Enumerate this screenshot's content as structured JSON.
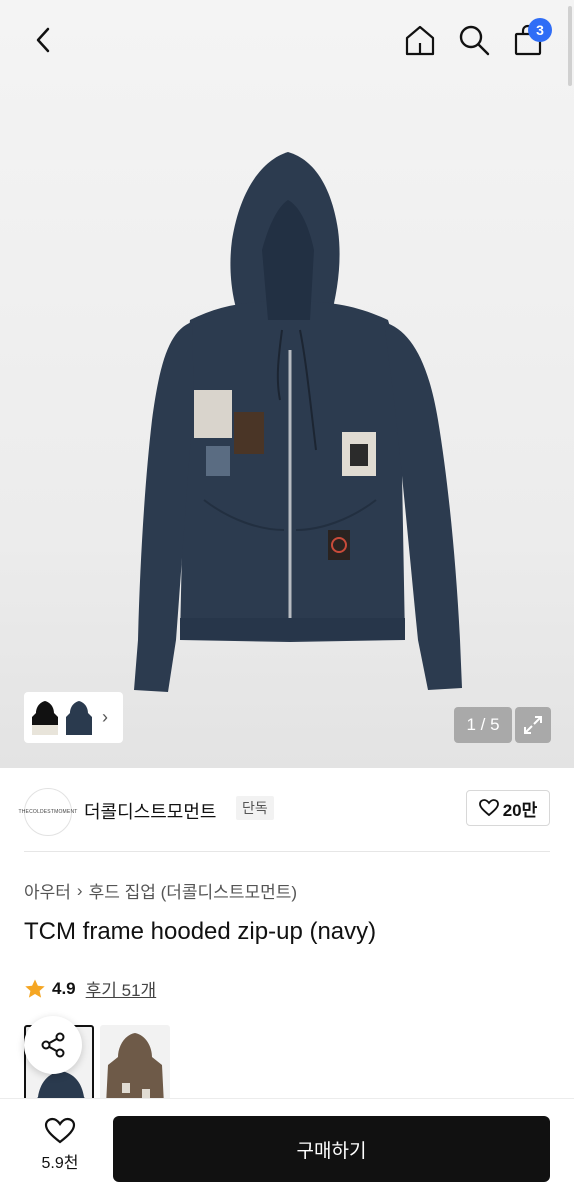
{
  "nav": {
    "bag_count": "3"
  },
  "gallery": {
    "counter": "1 / 5"
  },
  "brand": {
    "logo_text": "THECOLDESTMOMENT",
    "name": "더콜디스트모먼트",
    "tag": "단독",
    "likes": "20만"
  },
  "product": {
    "breadcrumb": [
      "아우터",
      "후드 집업 (더콜디스트모먼트)"
    ],
    "title": "TCM frame hooded zip-up (navy)",
    "rating": "4.9",
    "reviews": "후기 51개"
  },
  "bottom": {
    "wish_count": "5.9천",
    "buy_label": "구매하기"
  },
  "colors": {
    "navy": "#2a3a4e",
    "brown": "#6e5a48",
    "star": "#f5a623",
    "badge": "#2f6df6"
  },
  "icons": [
    "back-icon",
    "home-icon",
    "search-icon",
    "bag-icon",
    "expand-icon",
    "heart-icon",
    "share-icon",
    "star-icon",
    "chevron-right-icon"
  ]
}
